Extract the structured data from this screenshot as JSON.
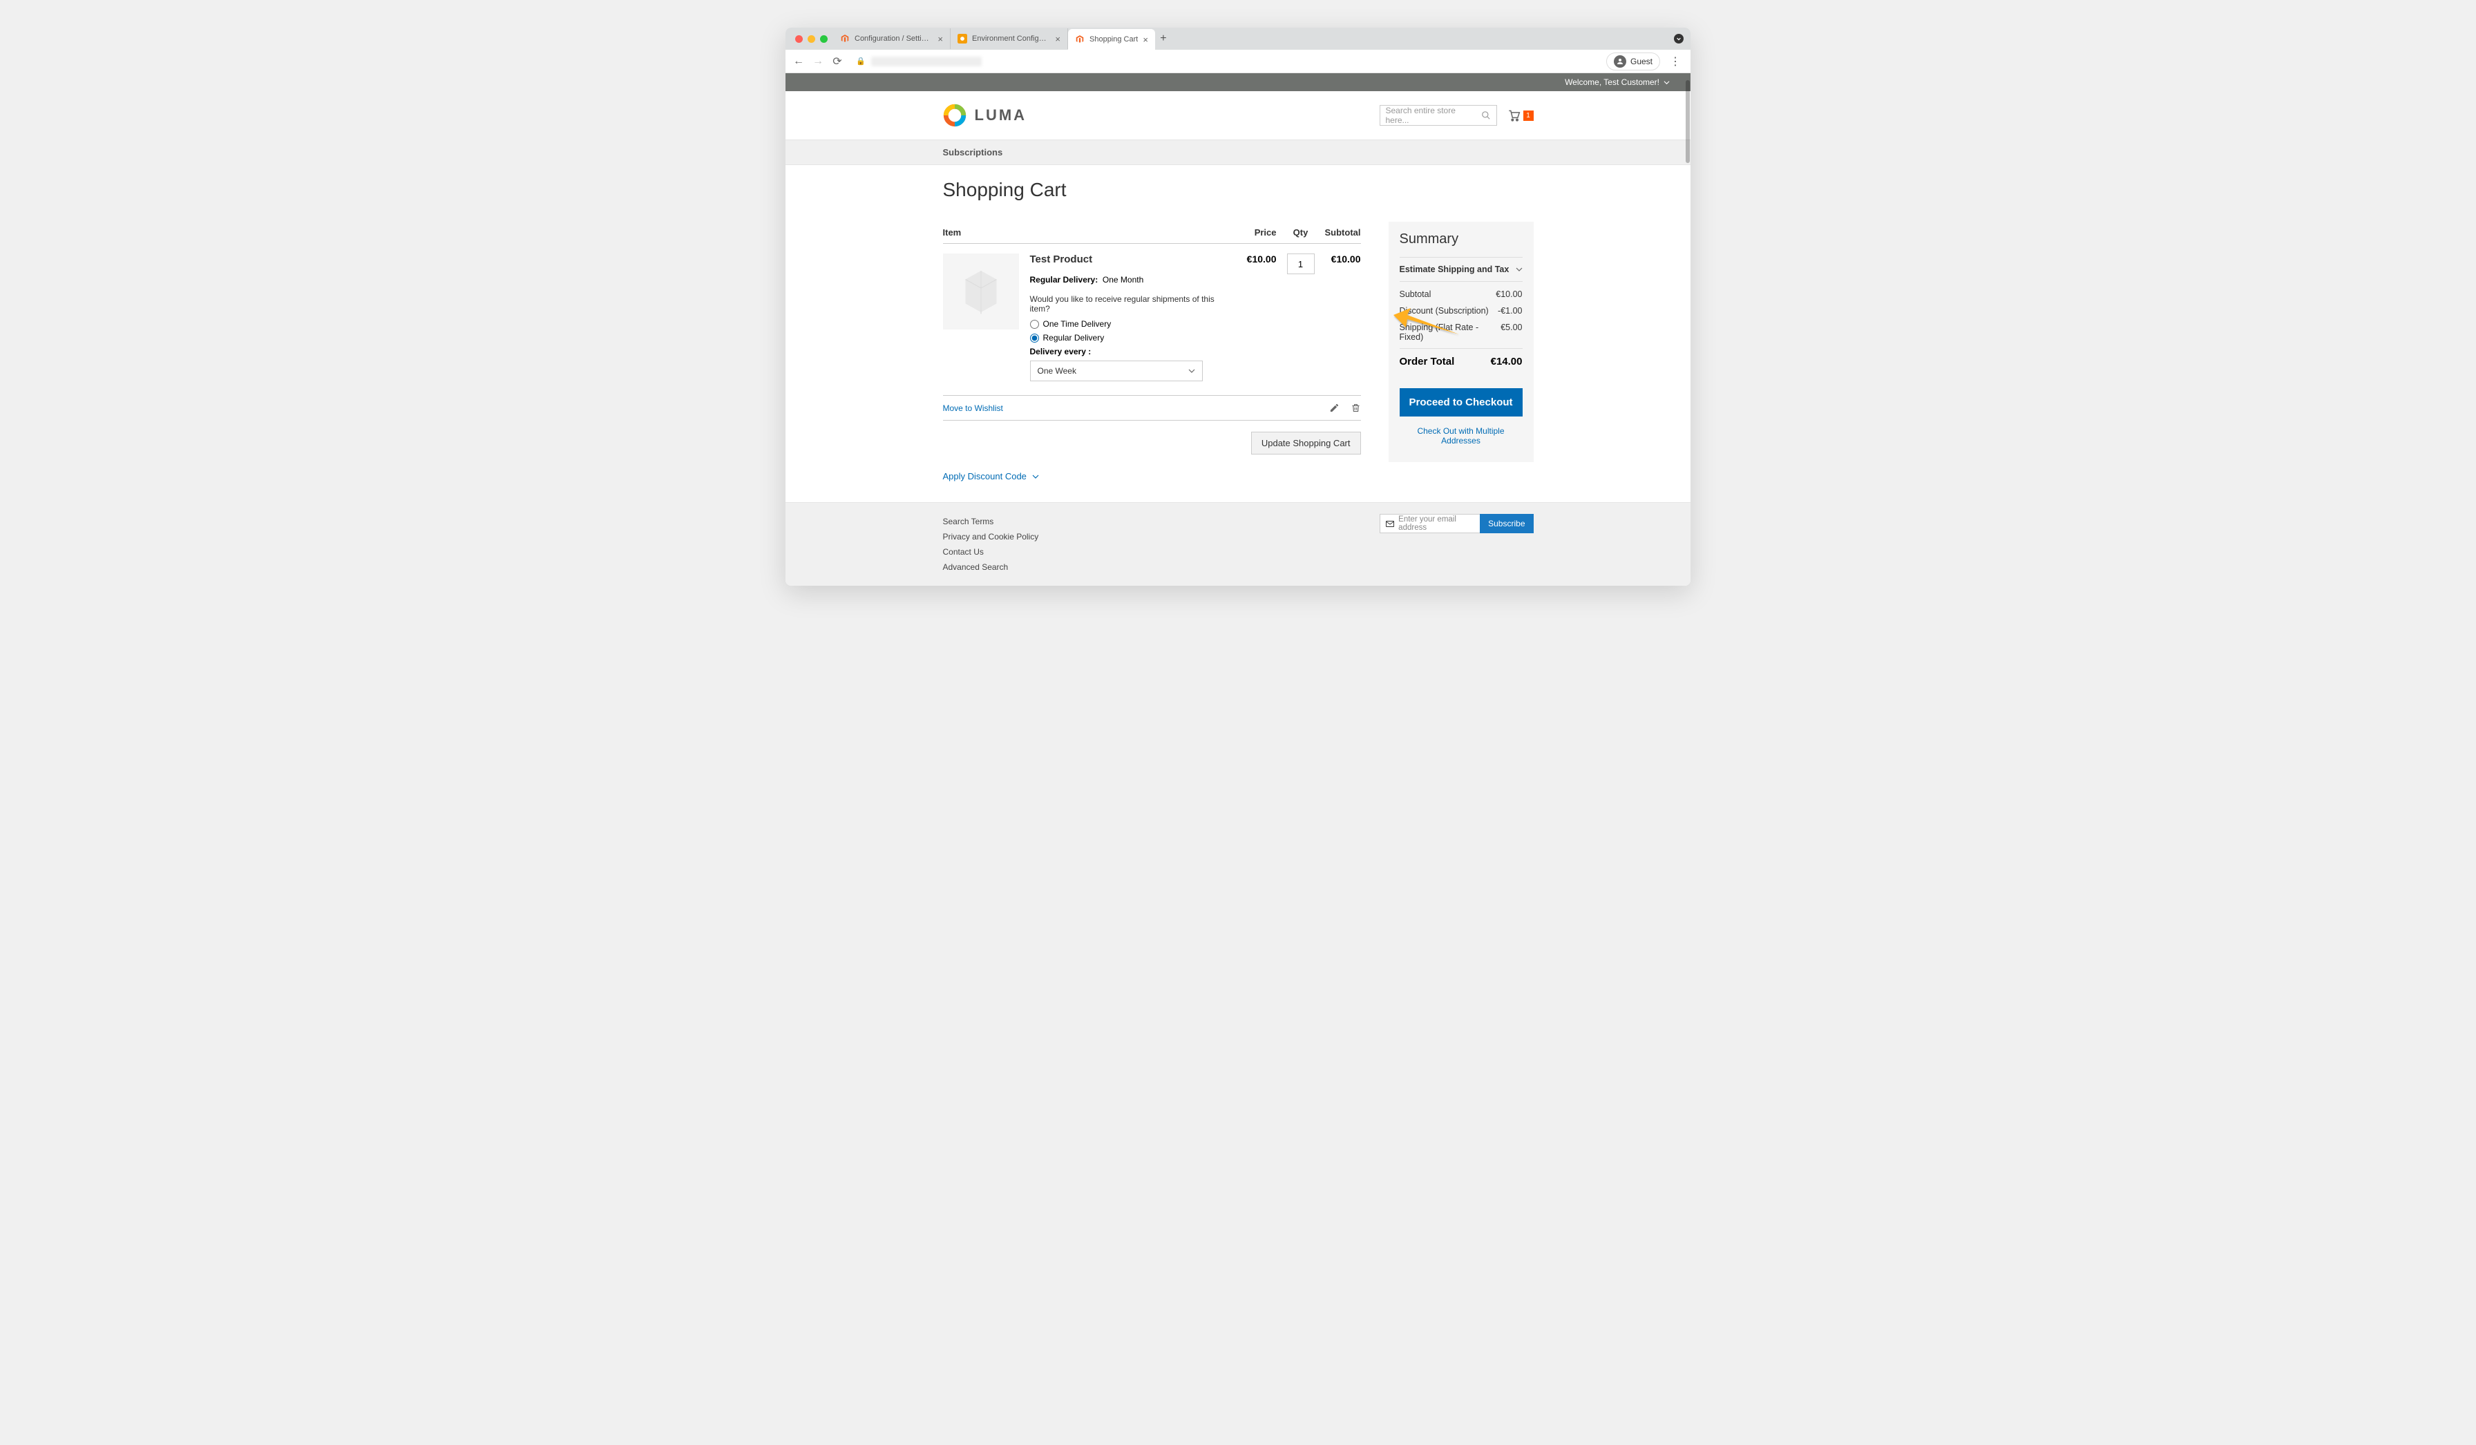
{
  "browser": {
    "tabs": [
      {
        "label": "Configuration / Settings / Store"
      },
      {
        "label": "Environment Configuration for"
      },
      {
        "label": "Shopping Cart"
      }
    ],
    "active_tab": 2,
    "guest_label": "Guest"
  },
  "topbar": {
    "welcome": "Welcome, Test Customer!"
  },
  "header": {
    "logo_text": "LUMA",
    "search_placeholder": "Search entire store here...",
    "cart_count": "1"
  },
  "nav": {
    "item": "Subscriptions"
  },
  "page_title": "Shopping Cart",
  "table": {
    "headers": {
      "item": "Item",
      "price": "Price",
      "qty": "Qty",
      "subtotal": "Subtotal"
    },
    "product": {
      "name": "Test Product",
      "regular_delivery_label": "Regular Delivery:",
      "regular_delivery_value": "One Month",
      "question": "Would you like to receive regular shipments of this item?",
      "opt_one_time": "One Time Delivery",
      "opt_regular": "Regular Delivery",
      "delivery_every_label": "Delivery every :",
      "delivery_every_value": "One Week",
      "price": "€10.00",
      "qty": "1",
      "subtotal": "€10.00"
    },
    "move_to_wishlist": "Move to Wishlist",
    "update_cart": "Update Shopping Cart",
    "discount_code": "Apply Discount Code"
  },
  "summary": {
    "title": "Summary",
    "estimate": "Estimate Shipping and Tax",
    "lines": [
      {
        "label": "Subtotal",
        "value": "€10.00"
      },
      {
        "label": "Discount (Subscription)",
        "value": "-€1.00"
      },
      {
        "label": "Shipping (Flat Rate - Fixed)",
        "value": "€5.00"
      }
    ],
    "order_total_label": "Order Total",
    "order_total_value": "€14.00",
    "checkout": "Proceed to Checkout",
    "multi": "Check Out with Multiple Addresses"
  },
  "footer": {
    "links": [
      "Search Terms",
      "Privacy and Cookie Policy",
      "Contact Us",
      "Advanced Search"
    ],
    "email_placeholder": "Enter your email address",
    "subscribe": "Subscribe"
  }
}
